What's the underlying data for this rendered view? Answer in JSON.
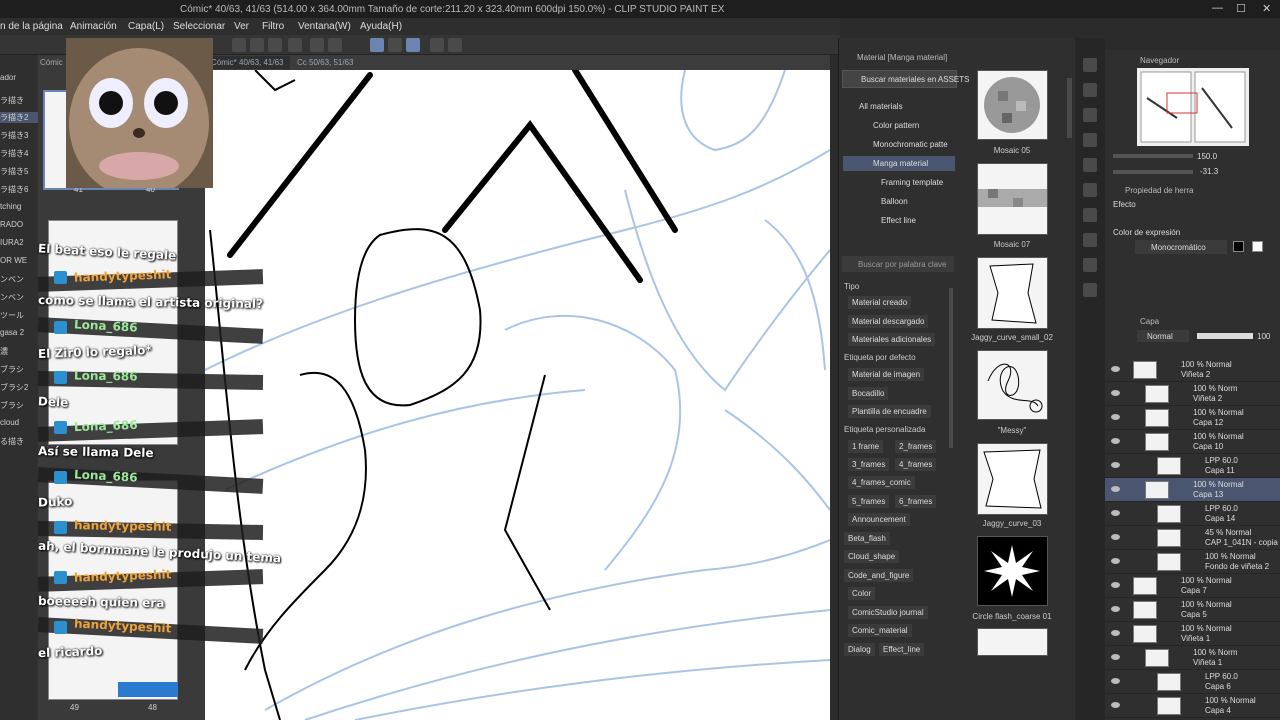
{
  "titlebar": {
    "title": "Cómic* 40/63, 41/63 (514.00 x 364.00mm Tamaño de corte:211.20 x 323.40mm 600dpi 150.0%) - CLIP STUDIO PAINT EX",
    "min": "—",
    "max": "☐",
    "close": "✕"
  },
  "menu": [
    "n de la página",
    "Animación",
    "Capa(L)",
    "Seleccionar",
    "Ver",
    "Filtro",
    "Ventana(W)",
    "Ayuda(H)"
  ],
  "left_labels": [
    "ador",
    "ラ描き",
    "ラ描き2",
    "ラ描き3",
    "ラ描き4",
    "ラ描き5",
    "ラ描き6",
    "tching",
    "RADO",
    "IURA2",
    "OR WE",
    "ンベン",
    "ンベン",
    "ツール",
    "gasa 2",
    "濃",
    "ブラシ",
    "ブラシ2",
    "ブラシ",
    "cloud",
    "る描き"
  ],
  "page_tabs": [
    "Cómic* 40/63, 41/63",
    "Cc 50/63, 51/63"
  ],
  "page_numbers": [
    "41",
    "40",
    "49",
    "48"
  ],
  "pages_tab": "Cómic",
  "chat": [
    {
      "type": "msg",
      "text": "El beat eso le regale"
    },
    {
      "type": "user",
      "name": "handytypeshit",
      "color": "#f0a23a"
    },
    {
      "type": "msg",
      "text": "como se llama el artista original?"
    },
    {
      "type": "user",
      "name": "Lona_686",
      "color": "#7ee07e"
    },
    {
      "type": "msg",
      "text": "El Zir0 lo regalo*"
    },
    {
      "type": "user",
      "name": "Lona_686",
      "color": "#7ee07e"
    },
    {
      "type": "msg",
      "text": "Dele"
    },
    {
      "type": "user",
      "name": "Lona_686",
      "color": "#7ee07e"
    },
    {
      "type": "msg",
      "text": "Así se llama Dele"
    },
    {
      "type": "user",
      "name": "Lona_686",
      "color": "#7ee07e"
    },
    {
      "type": "msg",
      "text": "Duko"
    },
    {
      "type": "user",
      "name": "handytypeshit",
      "color": "#f0a23a"
    },
    {
      "type": "msg",
      "text": "ah, el bornmane le produjo un tema"
    },
    {
      "type": "user",
      "name": "handytypeshit",
      "color": "#f0a23a"
    },
    {
      "type": "msg",
      "text": "boeeeeh quien era"
    },
    {
      "type": "user",
      "name": "handytypeshit",
      "color": "#f0a23a"
    },
    {
      "type": "msg",
      "text": "el ricardo"
    }
  ],
  "material": {
    "panel_title": "Material [Manga material]",
    "assets_button": "Buscar materiales en ASSETS",
    "tree": [
      "All materials",
      "Color pattern",
      "Monochromatic patte",
      "Manga material",
      "Framing template",
      "Balloon",
      "Effect line"
    ],
    "search_placeholder": "Buscar por palabra clave",
    "tipo_label": "Tipo",
    "tipo_tags": [
      "Material creado",
      "Material descargado",
      "Materiales adicionales"
    ],
    "default_label": "Etiqueta por defecto",
    "default_tags": [
      "Material de imagen",
      "Bocadillo",
      "Plantilla de encuadre"
    ],
    "custom_label": "Etiqueta personalizada",
    "custom_tags": [
      "1 frame",
      "2_frames",
      "3_frames",
      "4_frames",
      "4_frames_comic",
      "5_frames",
      "6_frames",
      "Announcement",
      "Beta_flash",
      "Cloud_shape",
      "Code_and_figure",
      "Color",
      "ComicStudio journal",
      "Comic_material",
      "Dialog",
      "Effect_line"
    ],
    "thumbs": [
      "Mosaic 05",
      "Mosaic 07",
      "Jaggy_curve_small_02",
      "\"Messy\"",
      "Jaggy_curve_03",
      "Circle flash_coarse 01"
    ]
  },
  "navigator": {
    "title": "Navegador",
    "zoom": "150.0",
    "rotation": "-31.3"
  },
  "property": {
    "title": "Propiedad de herra",
    "effect": "Efecto",
    "color_expr": "Color de expresión",
    "mode": "Monocromático"
  },
  "layer": {
    "title": "Capa",
    "blend": "Normal",
    "opacity": "100",
    "rows": [
      {
        "mode": "100 % Normal",
        "name": "Viñeta 2",
        "indent": 0
      },
      {
        "mode": "100 % Norm",
        "name": "Viñeta 2",
        "indent": 1
      },
      {
        "mode": "100 % Normal",
        "name": "Capa 12",
        "indent": 1
      },
      {
        "mode": "100 % Normal",
        "name": "Capa 10",
        "indent": 1
      },
      {
        "mode": "LPP 60.0",
        "name": "Capa 11",
        "indent": 2
      },
      {
        "mode": "100 % Normal",
        "name": "Capa 13",
        "indent": 1
      },
      {
        "mode": "LPP 60.0",
        "name": "Capa 14",
        "indent": 2
      },
      {
        "mode": "45 % Normal",
        "name": "CAP 1_041N - copia",
        "indent": 2
      },
      {
        "mode": "100 % Normal",
        "name": "Fondo de viñeta 2",
        "indent": 2
      },
      {
        "mode": "100 % Normal",
        "name": "Capa 7",
        "indent": 0
      },
      {
        "mode": "100 % Normal",
        "name": "Capa 5",
        "indent": 0
      },
      {
        "mode": "100 % Normal",
        "name": "Viñeta 1",
        "indent": 0
      },
      {
        "mode": "100 % Norm",
        "name": "Viñeta 1",
        "indent": 1
      },
      {
        "mode": "LPP 60.0",
        "name": "Capa 6",
        "indent": 2
      },
      {
        "mode": "100 % Normal",
        "name": "Capa 4",
        "indent": 2
      }
    ],
    "selected_index": 5
  },
  "colors": {
    "accent": "#6a86b0",
    "selection": "#4a5670",
    "sketch_blue": "#a9c4e6"
  }
}
